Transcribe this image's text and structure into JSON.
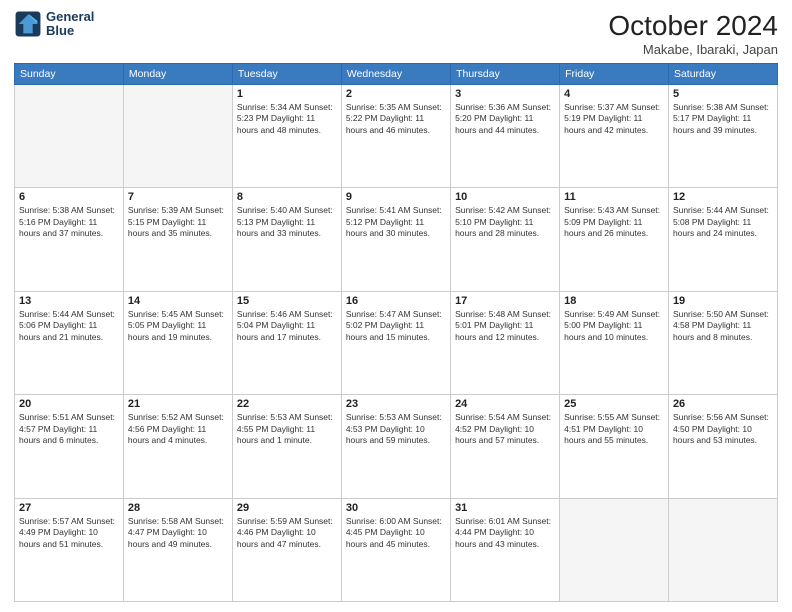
{
  "logo": {
    "line1": "General",
    "line2": "Blue"
  },
  "title": "October 2024",
  "location": "Makabe, Ibaraki, Japan",
  "days_of_week": [
    "Sunday",
    "Monday",
    "Tuesday",
    "Wednesday",
    "Thursday",
    "Friday",
    "Saturday"
  ],
  "weeks": [
    [
      {
        "day": "",
        "info": ""
      },
      {
        "day": "",
        "info": ""
      },
      {
        "day": "1",
        "info": "Sunrise: 5:34 AM\nSunset: 5:23 PM\nDaylight: 11 hours and 48 minutes."
      },
      {
        "day": "2",
        "info": "Sunrise: 5:35 AM\nSunset: 5:22 PM\nDaylight: 11 hours and 46 minutes."
      },
      {
        "day": "3",
        "info": "Sunrise: 5:36 AM\nSunset: 5:20 PM\nDaylight: 11 hours and 44 minutes."
      },
      {
        "day": "4",
        "info": "Sunrise: 5:37 AM\nSunset: 5:19 PM\nDaylight: 11 hours and 42 minutes."
      },
      {
        "day": "5",
        "info": "Sunrise: 5:38 AM\nSunset: 5:17 PM\nDaylight: 11 hours and 39 minutes."
      }
    ],
    [
      {
        "day": "6",
        "info": "Sunrise: 5:38 AM\nSunset: 5:16 PM\nDaylight: 11 hours and 37 minutes."
      },
      {
        "day": "7",
        "info": "Sunrise: 5:39 AM\nSunset: 5:15 PM\nDaylight: 11 hours and 35 minutes."
      },
      {
        "day": "8",
        "info": "Sunrise: 5:40 AM\nSunset: 5:13 PM\nDaylight: 11 hours and 33 minutes."
      },
      {
        "day": "9",
        "info": "Sunrise: 5:41 AM\nSunset: 5:12 PM\nDaylight: 11 hours and 30 minutes."
      },
      {
        "day": "10",
        "info": "Sunrise: 5:42 AM\nSunset: 5:10 PM\nDaylight: 11 hours and 28 minutes."
      },
      {
        "day": "11",
        "info": "Sunrise: 5:43 AM\nSunset: 5:09 PM\nDaylight: 11 hours and 26 minutes."
      },
      {
        "day": "12",
        "info": "Sunrise: 5:44 AM\nSunset: 5:08 PM\nDaylight: 11 hours and 24 minutes."
      }
    ],
    [
      {
        "day": "13",
        "info": "Sunrise: 5:44 AM\nSunset: 5:06 PM\nDaylight: 11 hours and 21 minutes."
      },
      {
        "day": "14",
        "info": "Sunrise: 5:45 AM\nSunset: 5:05 PM\nDaylight: 11 hours and 19 minutes."
      },
      {
        "day": "15",
        "info": "Sunrise: 5:46 AM\nSunset: 5:04 PM\nDaylight: 11 hours and 17 minutes."
      },
      {
        "day": "16",
        "info": "Sunrise: 5:47 AM\nSunset: 5:02 PM\nDaylight: 11 hours and 15 minutes."
      },
      {
        "day": "17",
        "info": "Sunrise: 5:48 AM\nSunset: 5:01 PM\nDaylight: 11 hours and 12 minutes."
      },
      {
        "day": "18",
        "info": "Sunrise: 5:49 AM\nSunset: 5:00 PM\nDaylight: 11 hours and 10 minutes."
      },
      {
        "day": "19",
        "info": "Sunrise: 5:50 AM\nSunset: 4:58 PM\nDaylight: 11 hours and 8 minutes."
      }
    ],
    [
      {
        "day": "20",
        "info": "Sunrise: 5:51 AM\nSunset: 4:57 PM\nDaylight: 11 hours and 6 minutes."
      },
      {
        "day": "21",
        "info": "Sunrise: 5:52 AM\nSunset: 4:56 PM\nDaylight: 11 hours and 4 minutes."
      },
      {
        "day": "22",
        "info": "Sunrise: 5:53 AM\nSunset: 4:55 PM\nDaylight: 11 hours and 1 minute."
      },
      {
        "day": "23",
        "info": "Sunrise: 5:53 AM\nSunset: 4:53 PM\nDaylight: 10 hours and 59 minutes."
      },
      {
        "day": "24",
        "info": "Sunrise: 5:54 AM\nSunset: 4:52 PM\nDaylight: 10 hours and 57 minutes."
      },
      {
        "day": "25",
        "info": "Sunrise: 5:55 AM\nSunset: 4:51 PM\nDaylight: 10 hours and 55 minutes."
      },
      {
        "day": "26",
        "info": "Sunrise: 5:56 AM\nSunset: 4:50 PM\nDaylight: 10 hours and 53 minutes."
      }
    ],
    [
      {
        "day": "27",
        "info": "Sunrise: 5:57 AM\nSunset: 4:49 PM\nDaylight: 10 hours and 51 minutes."
      },
      {
        "day": "28",
        "info": "Sunrise: 5:58 AM\nSunset: 4:47 PM\nDaylight: 10 hours and 49 minutes."
      },
      {
        "day": "29",
        "info": "Sunrise: 5:59 AM\nSunset: 4:46 PM\nDaylight: 10 hours and 47 minutes."
      },
      {
        "day": "30",
        "info": "Sunrise: 6:00 AM\nSunset: 4:45 PM\nDaylight: 10 hours and 45 minutes."
      },
      {
        "day": "31",
        "info": "Sunrise: 6:01 AM\nSunset: 4:44 PM\nDaylight: 10 hours and 43 minutes."
      },
      {
        "day": "",
        "info": ""
      },
      {
        "day": "",
        "info": ""
      }
    ]
  ]
}
